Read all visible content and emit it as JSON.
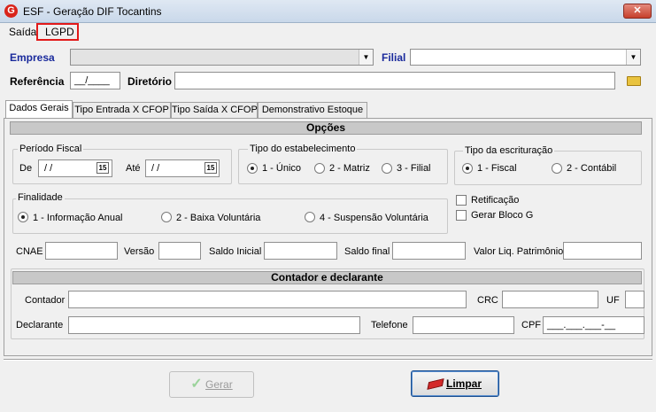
{
  "window": {
    "title": "ESF - Geração DIF Tocantins",
    "app_icon_letter": "G",
    "close_glyph": "✕"
  },
  "menu": {
    "items": [
      "Saída",
      "LGPD"
    ]
  },
  "header": {
    "empresa_label": "Empresa",
    "filial_label": "Filial",
    "referencia_label": "Referência",
    "referencia_value": "__/____",
    "diretorio_label": "Diretório",
    "diretorio_value": "",
    "combo_arrow": "▼"
  },
  "tabs": [
    "Dados Gerais",
    "Tipo Entrada X CFOP",
    "Tipo Saída X CFOP",
    "Demonstrativo Estoque"
  ],
  "opcoes": {
    "title": "Opções",
    "periodo": {
      "title": "Período Fiscal",
      "de_label": "De",
      "de_value": "/ /",
      "ate_label": "Até",
      "ate_value": "/ /",
      "cal_glyph": "15"
    },
    "tipo_estab": {
      "title": "Tipo do estabelecimento",
      "options": [
        "1 - Único",
        "2 - Matriz",
        "3 - Filial"
      ],
      "selected": 0
    },
    "tipo_escrit": {
      "title": "Tipo da escrituração",
      "options": [
        "1 - Fiscal",
        "2 - Contábil"
      ],
      "selected": 0
    },
    "finalidade": {
      "title": "Finalidade",
      "options": [
        "1 - Informação Anual",
        "2 - Baixa Voluntária",
        "4 - Suspensão Voluntária"
      ],
      "selected": 0
    },
    "checks": {
      "retificacao": "Retificação",
      "gerar_bloco_g": "Gerar Bloco G"
    },
    "fields": {
      "cnae": "CNAE",
      "versao": "Versão",
      "saldo_inicial": "Saldo Inicial",
      "saldo_final": "Saldo final",
      "valor_liq": "Valor Liq. Patrimônio"
    }
  },
  "contador": {
    "title": "Contador e declarante",
    "contador_label": "Contador",
    "crc_label": "CRC",
    "uf_label": "UF",
    "declarante_label": "Declarante",
    "telefone_label": "Telefone",
    "cpf_label": "CPF",
    "cpf_value": "___.___.___-__"
  },
  "buttons": {
    "gerar": "Gerar",
    "gerar_icon": "✓",
    "limpar": "Limpar"
  },
  "colors": {
    "highlight_box": "#e21a1a",
    "label_blue": "#1a2a9c",
    "gerar_icon": "#9bd39b",
    "eraser": "#d42a2a"
  }
}
